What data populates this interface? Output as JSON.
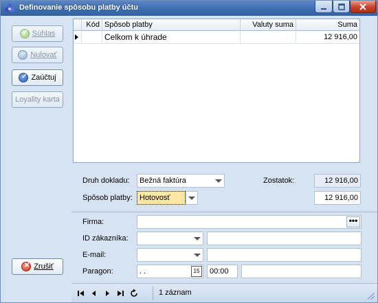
{
  "window": {
    "title": "Definovanie spôsobu platby účtu",
    "controls": {
      "minimize_icon": "minimize-icon",
      "maximize_icon": "maximize-icon",
      "close_icon": "close-icon"
    }
  },
  "sidebar": {
    "buttons": [
      {
        "label": "Súhlas",
        "enabled": false,
        "icon": "check-icon"
      },
      {
        "label": "Nulovať",
        "enabled": false,
        "icon": "minus-icon"
      },
      {
        "label": "Zaúčtuj",
        "enabled": true,
        "icon": "check-icon"
      },
      {
        "label": "Loyality karta",
        "enabled": false,
        "icon": ""
      }
    ],
    "cancel_label": "Zrušiť"
  },
  "grid": {
    "columns": [
      "",
      "Kód",
      "Spôsob platby",
      "Valuty suma",
      "Suma"
    ],
    "rows": [
      {
        "kod": "",
        "sposob": "Celkom k úhrade",
        "valuty": "",
        "suma": "12 916,00"
      }
    ]
  },
  "form": {
    "druh_dokladu_label": "Druh dokladu:",
    "druh_dokladu_value": "Bežná faktúra",
    "zostatok_label": "Zostatok:",
    "zostatok_value": "12 916,00",
    "sposob_platby_label": "Spôsob platby:",
    "sposob_platby_value": "Hotovosť",
    "sposob_platby_amount": "12 916,00",
    "firma_label": "Firma:",
    "firma_value": "",
    "firma_button": "•••",
    "id_zakaznika_label": "ID zákazníka:",
    "id_zakaznika_value": "",
    "id_zakaznika_text": "",
    "email_label": "E-mail:",
    "email_value": "",
    "email_text": "",
    "paragon_label": "Paragon:",
    "paragon_date": " .  .",
    "paragon_date_icon": "15",
    "paragon_time": "00:00",
    "paragon_number": ""
  },
  "navbar": {
    "record_count": "1 záznam"
  }
}
